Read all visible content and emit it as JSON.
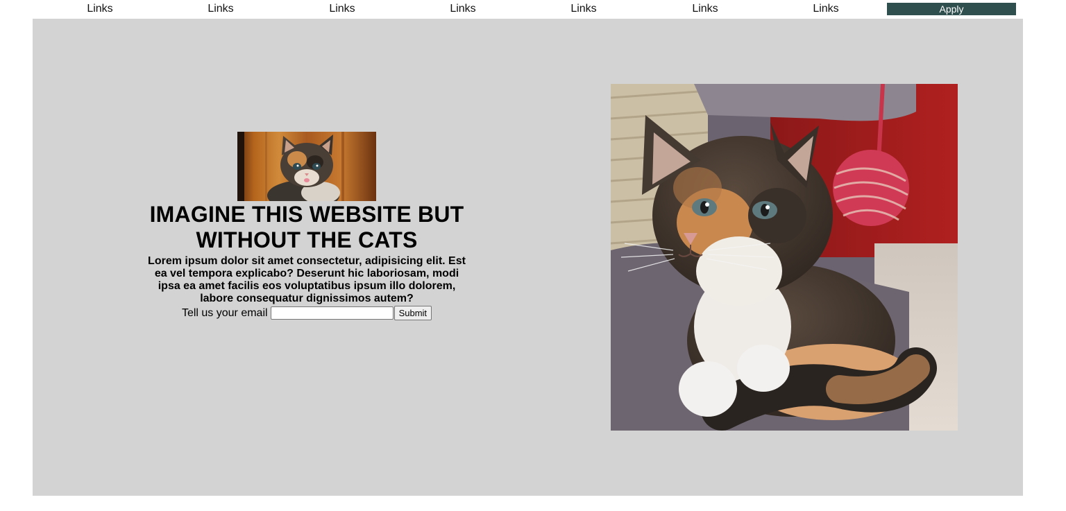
{
  "nav": {
    "links": [
      "Links",
      "Links",
      "Links",
      "Links",
      "Links",
      "Links",
      "Links"
    ],
    "apply_label": "Apply"
  },
  "hero": {
    "headline": "IMAGINE THIS WEBSITE BUT WITHOUT THE CATS",
    "lead": "Lorem ipsum dolor sit amet consectetur, adipisicing elit. Est ea vel tempora explicabo? Deserunt hic laboriosam, modi ipsa ea amet facilis eos voluptatibus ipsum illo dolorem, labore consequatur dignissimos autem?",
    "signup": {
      "label": "Tell us your email",
      "email_value": "",
      "submit_label": "Submit"
    }
  },
  "colors": {
    "panel_bg": "#d3d3d3",
    "apply_bg": "#2f4f4f"
  }
}
